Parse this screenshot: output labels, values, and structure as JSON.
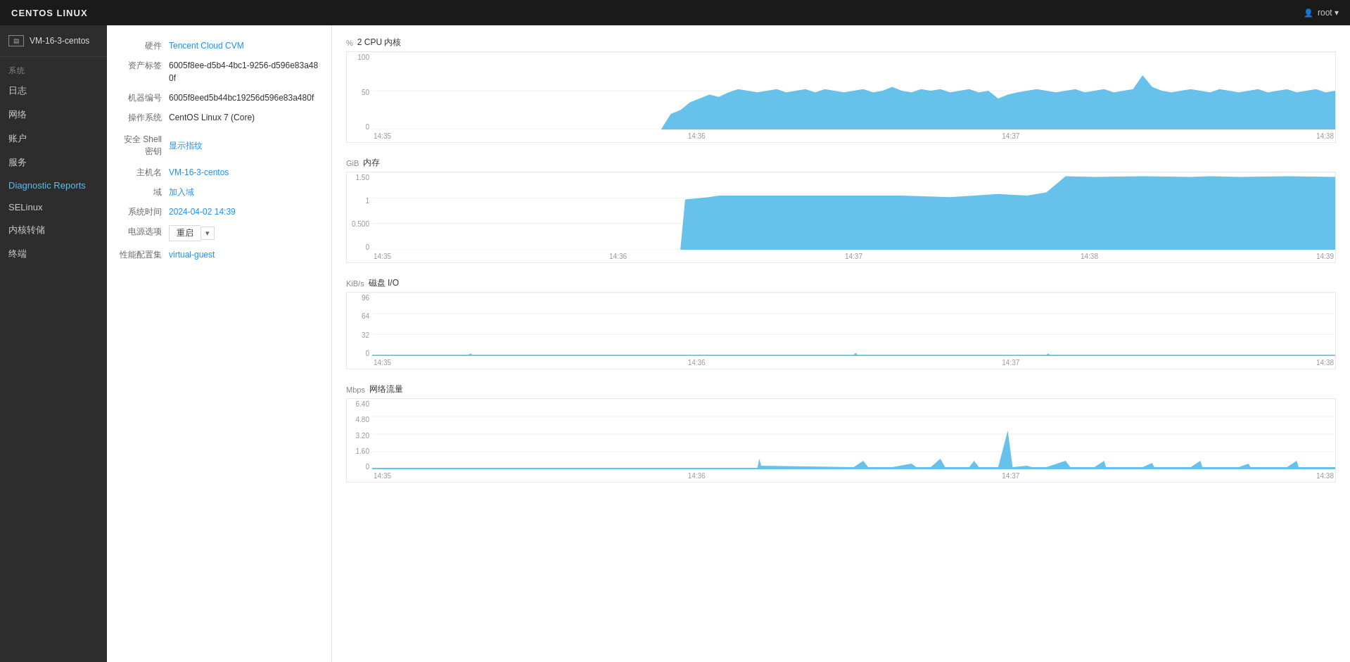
{
  "topbar": {
    "title": "CENTOS LINUX",
    "user": "root ▾"
  },
  "sidebar": {
    "vm_name": "VM-16-3-centos",
    "sections": [
      {
        "label": "系统",
        "type": "section"
      },
      {
        "label": "日志",
        "type": "item"
      },
      {
        "label": "网络",
        "type": "item"
      },
      {
        "label": "账户",
        "type": "item"
      },
      {
        "label": "服务",
        "type": "item"
      },
      {
        "label": "Diagnostic Reports",
        "type": "item"
      },
      {
        "label": "SELinux",
        "type": "item"
      },
      {
        "label": "内核转储",
        "type": "item"
      },
      {
        "label": "终端",
        "type": "item"
      }
    ]
  },
  "info": {
    "hardware_label": "硬件",
    "hardware_value": "Tencent Cloud CVM",
    "asset_label": "资产标签",
    "asset_value": "6005f8ee-d5b4-4bc1-9256-d596e83a480f",
    "machine_label": "机器编号",
    "machine_value": "6005f8eed5b44bc19256d596e83a480f",
    "os_label": "操作系统",
    "os_value": "CentOS Linux 7 (Core)",
    "ssh_label": "安全 Shell 密钥",
    "ssh_link": "显示指纹",
    "hostname_label": "主机名",
    "hostname_value": "VM-16-3-centos",
    "domain_label": "域",
    "domain_value": "加入域",
    "time_label": "系统时间",
    "time_value": "2024-04-02 14:39",
    "power_label": "电源选项",
    "power_value": "重启",
    "perf_label": "性能配置集",
    "perf_value": "virtual-guest"
  },
  "charts": {
    "cpu": {
      "unit": "%",
      "title": "2 CPU 内核",
      "y_labels": [
        "100",
        "50",
        "0"
      ],
      "x_labels": [
        "14:35",
        "14:36",
        "14:37",
        "14:38"
      ],
      "color": "#4db8e8"
    },
    "memory": {
      "unit": "GiB",
      "title": "内存",
      "y_labels": [
        "1.50",
        "1",
        "0.500",
        "0"
      ],
      "x_labels": [
        "14:35",
        "14:36",
        "14:37",
        "14:38",
        "14:39"
      ],
      "color": "#4db8e8"
    },
    "disk": {
      "unit": "KiB/s",
      "title": "磁盘 I/O",
      "y_labels": [
        "96",
        "64",
        "32",
        "0"
      ],
      "x_labels": [
        "14:35",
        "14:36",
        "14:37",
        "14:38"
      ],
      "color": "#4db8e8"
    },
    "network": {
      "unit": "Mbps",
      "title": "网络流量",
      "y_labels": [
        "6.40",
        "4.80",
        "3.20",
        "1.60",
        "0"
      ],
      "x_labels": [
        "14:35",
        "14:36",
        "14:37",
        "14:38"
      ],
      "color": "#4db8e8"
    }
  }
}
